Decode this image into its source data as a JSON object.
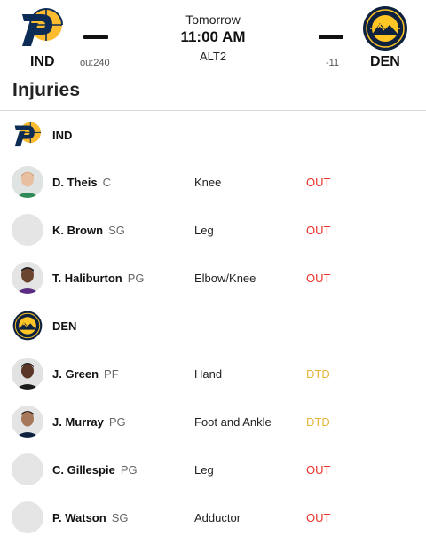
{
  "game": {
    "home": {
      "abbr": "IND",
      "odds": "ou:240"
    },
    "away": {
      "abbr": "DEN",
      "odds": "-11"
    },
    "day": "Tomorrow",
    "time": "11:00 AM",
    "channel": "ALT2"
  },
  "section_title": "Injuries",
  "colors": {
    "out": "#e8322a",
    "dtd": "#e5b53a",
    "pacers_navy": "#0c2c56",
    "pacers_gold": "#fdbb30",
    "nuggets_navy": "#0e2240",
    "nuggets_gold": "#fec524"
  },
  "teams": [
    {
      "abbr": "IND",
      "players": [
        {
          "name": "D. Theis",
          "pos": "C",
          "injury": "Knee",
          "status": "OUT"
        },
        {
          "name": "K. Brown",
          "pos": "SG",
          "injury": "Leg",
          "status": "OUT"
        },
        {
          "name": "T. Haliburton",
          "pos": "PG",
          "injury": "Elbow/Knee",
          "status": "OUT"
        }
      ]
    },
    {
      "abbr": "DEN",
      "players": [
        {
          "name": "J. Green",
          "pos": "PF",
          "injury": "Hand",
          "status": "DTD"
        },
        {
          "name": "J. Murray",
          "pos": "PG",
          "injury": "Foot and Ankle",
          "status": "DTD"
        },
        {
          "name": "C. Gillespie",
          "pos": "PG",
          "injury": "Leg",
          "status": "OUT"
        },
        {
          "name": "P. Watson",
          "pos": "SG",
          "injury": "Adductor",
          "status": "OUT"
        }
      ]
    }
  ]
}
